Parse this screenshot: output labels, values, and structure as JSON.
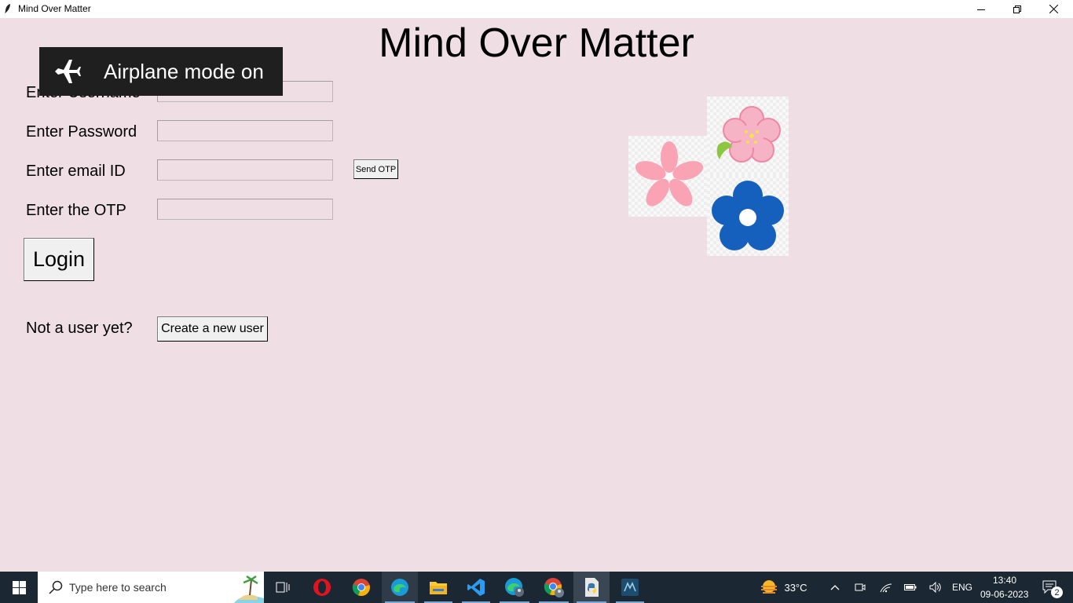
{
  "window": {
    "title": "Mind Over Matter"
  },
  "main": {
    "title": "Mind Over Matter"
  },
  "form": {
    "username_label": "Enter Username",
    "password_label": "Enter Password",
    "email_label": "Enter email ID",
    "otp_label": "Enter the OTP",
    "username_value": "",
    "password_value": "",
    "email_value": "",
    "otp_value": "",
    "send_otp_label": "Send OTP",
    "login_label": "Login",
    "not_user_label": "Not a user yet?",
    "create_user_label": "Create a new user"
  },
  "toast": {
    "text": "Airplane mode on",
    "icon": "airplane-icon"
  },
  "colors": {
    "background": "#efdfe5",
    "flower_pink": "#f9a3b5",
    "flower_blue": "#1560bd",
    "taskbar": "#1b2733"
  },
  "taskbar": {
    "search_placeholder": "Type here to search",
    "apps": [
      "task-view",
      "opera",
      "chrome",
      "edge",
      "file-explorer",
      "vscode",
      "edge-profile",
      "chrome-profile",
      "python",
      "mysql-workbench"
    ],
    "weather": "33°C",
    "language": "ENG",
    "time": "13:40",
    "date": "09-06-2023",
    "notification_count": "2"
  }
}
